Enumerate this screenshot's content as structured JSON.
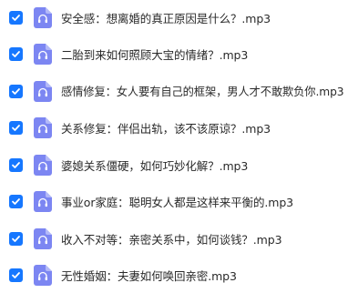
{
  "accent_color": "#1677ff",
  "file_icon_color": "#7c86f2",
  "file_icon_type": "audio-file-icon",
  "files": [
    {
      "name": "安全感：想离婚的真正原因是什么？.mp3",
      "checked": true
    },
    {
      "name": "二胎到来如何照顾大宝的情绪？.mp3",
      "checked": true
    },
    {
      "name": "感情修复：女人要有自己的框架，男人才不敢欺负你.mp3",
      "checked": true
    },
    {
      "name": "关系修复：伴侣出轨，该不该原谅？.mp3",
      "checked": true
    },
    {
      "name": "婆媳关系僵硬，如何巧妙化解？.mp3",
      "checked": true
    },
    {
      "name": "事业or家庭：聪明女人都是这样来平衡的.mp3",
      "checked": true
    },
    {
      "name": "收入不对等：亲密关系中，如何谈钱？.mp3",
      "checked": true
    },
    {
      "name": "无性婚姻：夫妻如何唤回亲密.mp3",
      "checked": true
    }
  ]
}
